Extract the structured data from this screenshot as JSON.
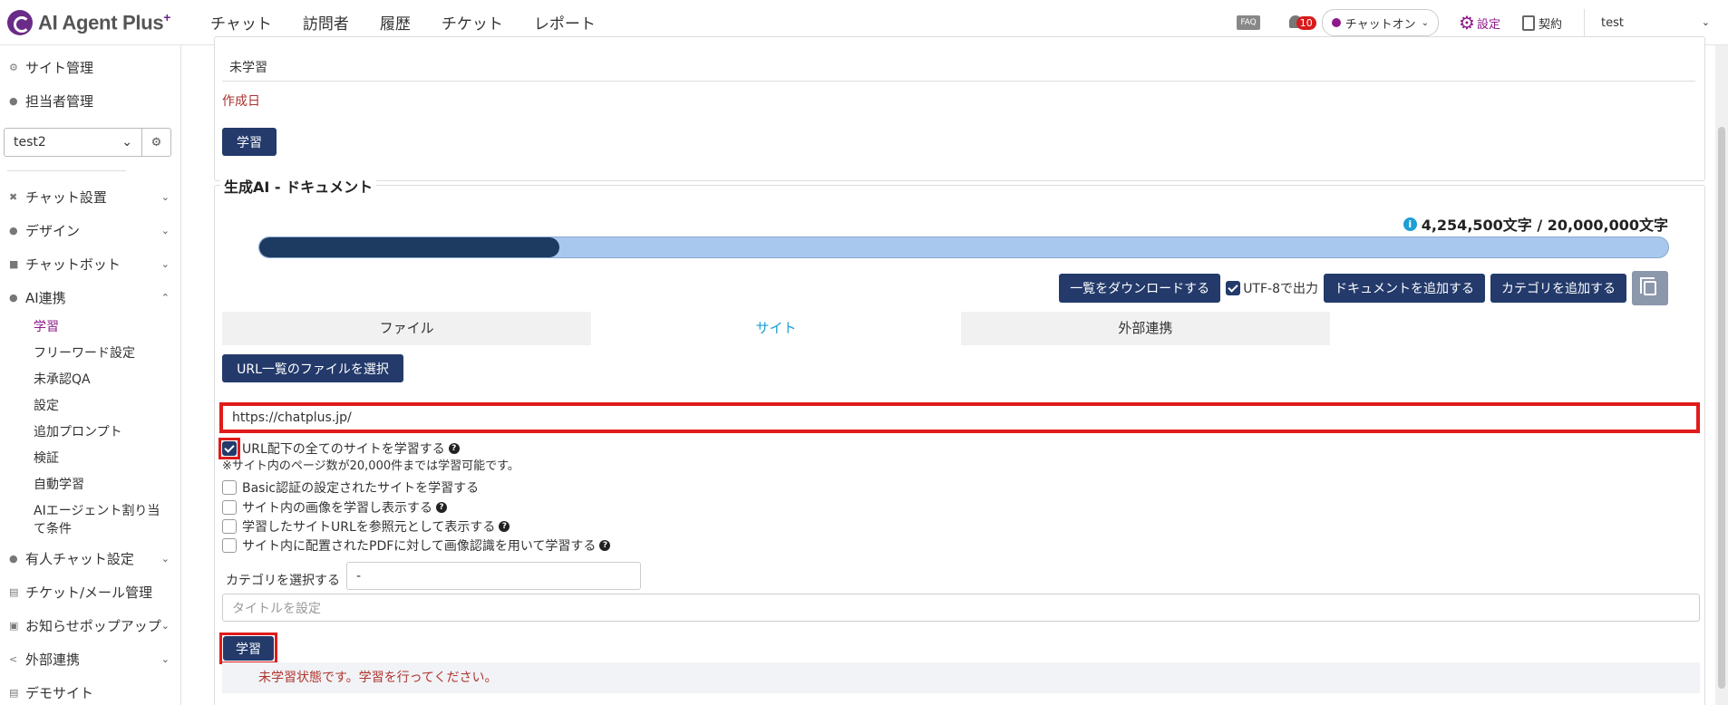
{
  "header": {
    "logo_text": "AI Agent Plus",
    "logo_plus": "+",
    "nav": [
      "チャット",
      "訪問者",
      "履歴",
      "チケット",
      "レポート"
    ],
    "faq": "FAQ",
    "notif_count": "10",
    "status": "チャットオン",
    "settings": "設定",
    "contract": "契約",
    "user": "test",
    "accent": "#8e1a8a"
  },
  "sidebar": {
    "top_items": [
      "サイト管理",
      "担当者管理"
    ],
    "site_select": "test2",
    "items": [
      {
        "label": "チャット設置",
        "icon": "tools-icon"
      },
      {
        "label": "デザイン",
        "icon": "palette-icon"
      },
      {
        "label": "チャットボット",
        "icon": "chat-icon"
      },
      {
        "label": "AI連携",
        "icon": "ai-icon"
      }
    ],
    "ai_sub": [
      "学習",
      "フリーワード設定",
      "未承認QA",
      "設定",
      "追加プロンプト",
      "検証",
      "自動学習",
      "AIエージェント割り当て条件"
    ],
    "bottom_items": [
      {
        "label": "有人チャット設定",
        "icon": "headset-icon"
      },
      {
        "label": "チケット/メール管理",
        "icon": "ticket-icon"
      },
      {
        "label": "お知らせポップアップ",
        "icon": "popup-icon"
      },
      {
        "label": "外部連携",
        "icon": "share-icon"
      },
      {
        "label": "デモサイト",
        "icon": "demo-icon"
      }
    ]
  },
  "card1": {
    "unlearned": "未学習",
    "created_label": "作成日",
    "learn": "学習"
  },
  "doc": {
    "legend": "生成AI - ドキュメント",
    "quota": "4,254,500文字 / 20,000,000文字",
    "progress": 0.2127,
    "download": "一覧をダウンロードする",
    "utf8": "UTF-8で出力",
    "add_doc": "ドキュメントを追加する",
    "add_cat": "カテゴリを追加する",
    "tabs": [
      "ファイル",
      "サイト",
      "外部連携"
    ],
    "url_file_btn": "URL一覧のファイルを選択",
    "url_value": "https://chatplus.jp/",
    "opt_all": "URL配下の全てのサイトを学習する",
    "note": "※サイト内のページ数が20,000件までは学習可能です。",
    "opt_basic": "Basic認証の設定されたサイトを学習する",
    "opt_images": "サイト内の画像を学習し表示する",
    "opt_ref": "学習したサイトURLを参照元として表示する",
    "opt_pdf": "サイト内に配置されたPDFに対して画像認識を用いて学習する",
    "cat_label": "カテゴリを選択する",
    "cat_value": "-",
    "title_placeholder": "タイトルを設定",
    "learn": "学習",
    "status_msg": "未学習状態です。学習を行ってください。"
  }
}
